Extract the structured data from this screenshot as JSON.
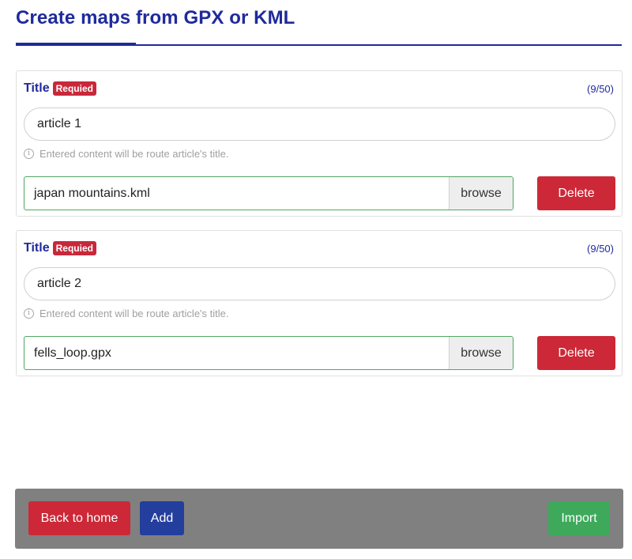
{
  "header": {
    "title": "Create maps from GPX or KML"
  },
  "entries": [
    {
      "label": "Title",
      "required_badge": "Requied",
      "counter": "(9/50)",
      "title_value": "article 1",
      "hint": "Entered content will be route article's title.",
      "file_name": "japan mountains.kml",
      "browse_label": "browse",
      "delete_label": "Delete"
    },
    {
      "label": "Title",
      "required_badge": "Requied",
      "counter": "(9/50)",
      "title_value": "article 2",
      "hint": "Entered content will be route article's title.",
      "file_name": "fells_loop.gpx",
      "browse_label": "browse",
      "delete_label": "Delete"
    }
  ],
  "footer": {
    "back_label": "Back to home",
    "add_label": "Add",
    "import_label": "Import"
  },
  "icons": {
    "hint_icon": "info-icon"
  },
  "colors": {
    "primary": "#1f2a9c",
    "danger": "#cc2837",
    "success": "#3ea95b",
    "footer_bg": "#808080"
  }
}
